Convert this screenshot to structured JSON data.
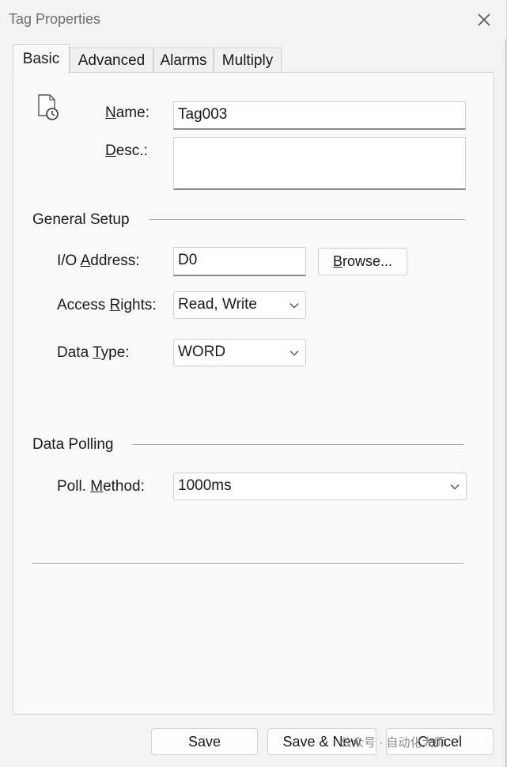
{
  "window": {
    "title": "Tag Properties"
  },
  "tabs": [
    {
      "label": "Basic"
    },
    {
      "label": "Advanced"
    },
    {
      "label": "Alarms"
    },
    {
      "label": "Multiply"
    }
  ],
  "basic": {
    "name_label_accel": "N",
    "name_label_rest": "ame:",
    "name_value": "Tag003",
    "desc_label_accel": "D",
    "desc_label_rest": "esc.:",
    "desc_value": ""
  },
  "general_setup": {
    "title": "General Setup",
    "io_label_pre": "I/O ",
    "io_label_accel": "A",
    "io_label_rest": "ddress:",
    "io_value": "D0",
    "browse_accel": "B",
    "browse_rest": "rowse...",
    "access_label_pre": "Access ",
    "access_label_accel": "R",
    "access_label_rest": "ights:",
    "access_value": "Read, Write",
    "type_label_pre": "Data ",
    "type_label_accel": "T",
    "type_label_rest": "ype:",
    "type_value": "WORD"
  },
  "data_polling": {
    "title": "Data Polling",
    "method_label_pre": "Poll. ",
    "method_label_accel": "M",
    "method_label_rest": "ethod:",
    "method_value": "1000ms"
  },
  "footer": {
    "save": "Save",
    "save_new": "Save & New",
    "cancel": "Cancel"
  },
  "watermark": "公众号 · 自动化大师",
  "icons": [
    "document-clock-icon",
    "close-icon",
    "chevron-down-icon"
  ]
}
